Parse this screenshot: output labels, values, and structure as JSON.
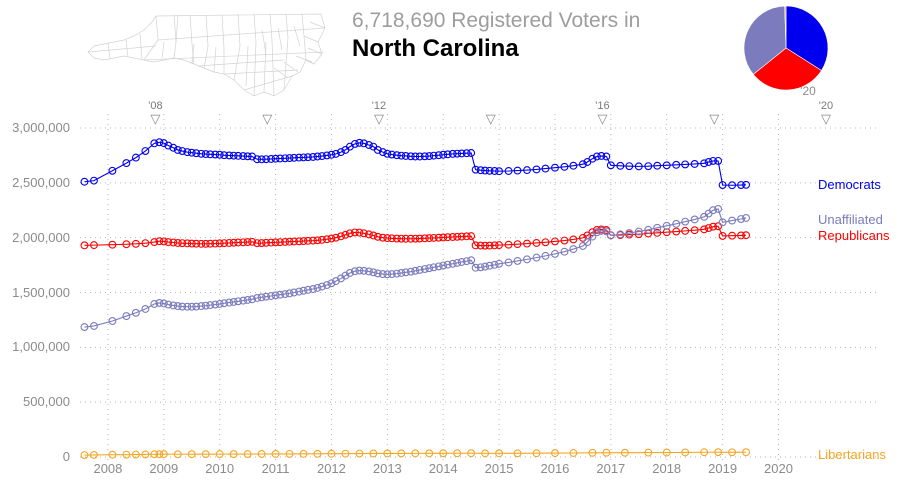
{
  "header": {
    "count_line": "6,718,690 Registered Voters in",
    "state": "North Carolina"
  },
  "map": {
    "name": "north-carolina-county-map"
  },
  "pie": {
    "label": "'20",
    "slices": [
      {
        "name": "Democrats",
        "percent": 34.0,
        "color": "#0000ee"
      },
      {
        "name": "Republicans",
        "percent": 30.2,
        "color": "#fe0000"
      },
      {
        "name": "Unaffiliated",
        "percent": 35.3,
        "color": "#7b7bbd"
      },
      {
        "name": "Libertarians",
        "percent": 0.5,
        "color": "#f5a623"
      }
    ]
  },
  "chart_data": {
    "type": "line",
    "title": "6,718,690 Registered Voters in North Carolina",
    "subtitle": "North Carolina",
    "xlabel": "",
    "ylabel": "",
    "ylim": [
      0,
      3000000
    ],
    "xlim": [
      2007.5,
      2020.6
    ],
    "grid": true,
    "legend_position": "right",
    "ytick_labels": [
      "3,000,000",
      "2,500,000",
      "2,000,000",
      "1,500,000",
      "1,000,000",
      "500,000",
      "0"
    ],
    "ytick_values": [
      3000000,
      2500000,
      2000000,
      1500000,
      1000000,
      500000,
      0
    ],
    "xtick_labels": [
      "2008",
      "2009",
      "2010",
      "2011",
      "2012",
      "2013",
      "2014",
      "2015",
      "2016",
      "2017",
      "2018",
      "2019",
      "2020"
    ],
    "xtick_values": [
      2008,
      2009,
      2010,
      2011,
      2012,
      2013,
      2014,
      2015,
      2016,
      2017,
      2018,
      2019,
      2020
    ],
    "election_markers": [
      {
        "label": "'08",
        "x": 2008.85
      },
      {
        "label": "",
        "x": 2010.85
      },
      {
        "label": "'12",
        "x": 2012.85
      },
      {
        "label": "",
        "x": 2014.85
      },
      {
        "label": "'16",
        "x": 2016.85
      },
      {
        "label": "",
        "x": 2018.85
      },
      {
        "label": "'20",
        "x": 2020.85
      }
    ],
    "series": [
      {
        "name": "Democrats",
        "color": "#0000ee",
        "label": "Democrats",
        "x": [
          2007.58,
          2007.75,
          2008.08,
          2008.33,
          2008.5,
          2008.67,
          2008.83,
          2008.92,
          2009.0,
          2009.08,
          2009.17,
          2009.25,
          2009.33,
          2009.42,
          2009.5,
          2009.58,
          2009.67,
          2009.75,
          2009.83,
          2009.92,
          2010.0,
          2010.08,
          2010.17,
          2010.25,
          2010.33,
          2010.42,
          2010.5,
          2010.58,
          2010.67,
          2010.75,
          2010.83,
          2010.92,
          2011.0,
          2011.08,
          2011.17,
          2011.25,
          2011.33,
          2011.42,
          2011.5,
          2011.58,
          2011.67,
          2011.75,
          2011.83,
          2011.92,
          2012.0,
          2012.08,
          2012.17,
          2012.25,
          2012.33,
          2012.42,
          2012.5,
          2012.58,
          2012.67,
          2012.75,
          2012.83,
          2012.92,
          2013.0,
          2013.08,
          2013.17,
          2013.25,
          2013.33,
          2013.42,
          2013.5,
          2013.58,
          2013.67,
          2013.75,
          2013.83,
          2013.92,
          2014.0,
          2014.08,
          2014.17,
          2014.25,
          2014.33,
          2014.42,
          2014.5,
          2014.58,
          2014.67,
          2014.75,
          2014.83,
          2014.92,
          2015.0,
          2015.17,
          2015.33,
          2015.5,
          2015.67,
          2015.83,
          2016.0,
          2016.17,
          2016.33,
          2016.5,
          2016.58,
          2016.67,
          2016.75,
          2016.83,
          2016.92,
          2017.0,
          2017.17,
          2017.33,
          2017.5,
          2017.67,
          2017.83,
          2018.0,
          2018.17,
          2018.33,
          2018.5,
          2018.67,
          2018.75,
          2018.83,
          2018.92,
          2019.0,
          2019.17,
          2019.33,
          2019.42
        ],
        "y": [
          2510000,
          2520000,
          2610000,
          2680000,
          2730000,
          2790000,
          2860000,
          2870000,
          2862000,
          2840000,
          2820000,
          2800000,
          2790000,
          2780000,
          2775000,
          2770000,
          2765000,
          2762000,
          2760000,
          2758000,
          2756000,
          2752000,
          2750000,
          2748000,
          2746000,
          2744000,
          2742000,
          2740000,
          2715000,
          2714000,
          2716000,
          2718000,
          2720000,
          2722000,
          2724000,
          2726000,
          2728000,
          2730000,
          2732000,
          2734000,
          2736000,
          2740000,
          2744000,
          2750000,
          2756000,
          2764000,
          2780000,
          2800000,
          2830000,
          2855000,
          2865000,
          2860000,
          2845000,
          2830000,
          2800000,
          2780000,
          2765000,
          2758000,
          2752000,
          2748000,
          2745000,
          2742000,
          2740000,
          2740000,
          2742000,
          2744000,
          2748000,
          2752000,
          2756000,
          2760000,
          2764000,
          2766000,
          2768000,
          2770000,
          2772000,
          2620000,
          2615000,
          2612000,
          2610000,
          2608000,
          2606000,
          2608000,
          2612000,
          2616000,
          2622000,
          2630000,
          2638000,
          2646000,
          2656000,
          2670000,
          2690000,
          2720000,
          2740000,
          2745000,
          2740000,
          2660000,
          2655000,
          2652000,
          2650000,
          2652000,
          2656000,
          2660000,
          2664000,
          2668000,
          2672000,
          2678000,
          2690000,
          2700000,
          2700000,
          2480000,
          2478000,
          2480000,
          2482000
        ]
      },
      {
        "name": "Republicans",
        "color": "#fe0000",
        "label": "Republicans",
        "x": [
          2007.58,
          2007.75,
          2008.08,
          2008.33,
          2008.5,
          2008.67,
          2008.83,
          2008.92,
          2009.0,
          2009.08,
          2009.17,
          2009.25,
          2009.33,
          2009.42,
          2009.5,
          2009.58,
          2009.67,
          2009.75,
          2009.83,
          2009.92,
          2010.0,
          2010.08,
          2010.17,
          2010.25,
          2010.33,
          2010.42,
          2010.5,
          2010.58,
          2010.67,
          2010.75,
          2010.83,
          2010.92,
          2011.0,
          2011.08,
          2011.17,
          2011.25,
          2011.33,
          2011.42,
          2011.5,
          2011.58,
          2011.67,
          2011.75,
          2011.83,
          2011.92,
          2012.0,
          2012.08,
          2012.17,
          2012.25,
          2012.33,
          2012.42,
          2012.5,
          2012.58,
          2012.67,
          2012.75,
          2012.83,
          2012.92,
          2013.0,
          2013.08,
          2013.17,
          2013.25,
          2013.33,
          2013.42,
          2013.5,
          2013.58,
          2013.67,
          2013.75,
          2013.83,
          2013.92,
          2014.0,
          2014.08,
          2014.17,
          2014.25,
          2014.33,
          2014.42,
          2014.5,
          2014.58,
          2014.67,
          2014.75,
          2014.83,
          2014.92,
          2015.0,
          2015.17,
          2015.33,
          2015.5,
          2015.67,
          2015.83,
          2016.0,
          2016.17,
          2016.33,
          2016.5,
          2016.58,
          2016.67,
          2016.75,
          2016.83,
          2016.92,
          2017.0,
          2017.17,
          2017.33,
          2017.5,
          2017.67,
          2017.83,
          2018.0,
          2018.17,
          2018.33,
          2018.5,
          2018.67,
          2018.75,
          2018.83,
          2018.92,
          2019.0,
          2019.17,
          2019.33,
          2019.42
        ],
        "y": [
          1930000,
          1932000,
          1936000,
          1940000,
          1944000,
          1950000,
          1960000,
          1968000,
          1966000,
          1960000,
          1956000,
          1952000,
          1950000,
          1948000,
          1946000,
          1945000,
          1944000,
          1944000,
          1945000,
          1946000,
          1948000,
          1950000,
          1952000,
          1954000,
          1956000,
          1958000,
          1960000,
          1962000,
          1950000,
          1951000,
          1953000,
          1955000,
          1957000,
          1959000,
          1961000,
          1963000,
          1965000,
          1967000,
          1969000,
          1971000,
          1973000,
          1976000,
          1980000,
          1986000,
          1992000,
          2000000,
          2012000,
          2026000,
          2040000,
          2048000,
          2046000,
          2040000,
          2030000,
          2020000,
          2008000,
          2000000,
          1996000,
          1994000,
          1992000,
          1991000,
          1990000,
          1990000,
          1991000,
          1992000,
          1994000,
          1996000,
          1998000,
          2000000,
          2002000,
          2004000,
          2006000,
          2008000,
          2010000,
          2012000,
          2014000,
          1930000,
          1928000,
          1927000,
          1928000,
          1930000,
          1932000,
          1936000,
          1941000,
          1946000,
          1952000,
          1958000,
          1966000,
          1974000,
          1984000,
          1998000,
          2020000,
          2050000,
          2070000,
          2075000,
          2070000,
          2022000,
          2024000,
          2028000,
          2032000,
          2038000,
          2044000,
          2050000,
          2056000,
          2062000,
          2068000,
          2076000,
          2088000,
          2100000,
          2104000,
          2016000,
          2018000,
          2020000,
          2022000
        ]
      },
      {
        "name": "Unaffiliated",
        "color": "#7b7bbd",
        "label": "Unaffiliated",
        "x": [
          2007.58,
          2007.75,
          2008.08,
          2008.33,
          2008.5,
          2008.67,
          2008.83,
          2008.92,
          2009.0,
          2009.08,
          2009.17,
          2009.25,
          2009.33,
          2009.42,
          2009.5,
          2009.58,
          2009.67,
          2009.75,
          2009.83,
          2009.92,
          2010.0,
          2010.08,
          2010.17,
          2010.25,
          2010.33,
          2010.42,
          2010.5,
          2010.58,
          2010.67,
          2010.75,
          2010.83,
          2010.92,
          2011.0,
          2011.08,
          2011.17,
          2011.25,
          2011.33,
          2011.42,
          2011.5,
          2011.58,
          2011.67,
          2011.75,
          2011.83,
          2011.92,
          2012.0,
          2012.08,
          2012.17,
          2012.25,
          2012.33,
          2012.42,
          2012.5,
          2012.58,
          2012.67,
          2012.75,
          2012.83,
          2012.92,
          2013.0,
          2013.08,
          2013.17,
          2013.25,
          2013.33,
          2013.42,
          2013.5,
          2013.58,
          2013.67,
          2013.75,
          2013.83,
          2013.92,
          2014.0,
          2014.08,
          2014.17,
          2014.25,
          2014.33,
          2014.42,
          2014.5,
          2014.58,
          2014.67,
          2014.75,
          2014.83,
          2014.92,
          2015.0,
          2015.17,
          2015.33,
          2015.5,
          2015.67,
          2015.83,
          2016.0,
          2016.17,
          2016.33,
          2016.5,
          2016.58,
          2016.67,
          2016.75,
          2016.83,
          2016.92,
          2017.0,
          2017.17,
          2017.33,
          2017.5,
          2017.67,
          2017.83,
          2018.0,
          2018.17,
          2018.33,
          2018.5,
          2018.67,
          2018.75,
          2018.83,
          2018.92,
          2019.0,
          2019.17,
          2019.33,
          2019.42
        ],
        "y": [
          1185000,
          1195000,
          1240000,
          1285000,
          1315000,
          1350000,
          1395000,
          1405000,
          1400000,
          1390000,
          1382000,
          1376000,
          1372000,
          1370000,
          1370000,
          1372000,
          1376000,
          1380000,
          1385000,
          1390000,
          1396000,
          1402000,
          1408000,
          1414000,
          1420000,
          1426000,
          1432000,
          1438000,
          1450000,
          1456000,
          1462000,
          1468000,
          1474000,
          1480000,
          1486000,
          1492000,
          1500000,
          1508000,
          1516000,
          1524000,
          1532000,
          1542000,
          1554000,
          1568000,
          1584000,
          1604000,
          1628000,
          1654000,
          1678000,
          1694000,
          1700000,
          1698000,
          1692000,
          1684000,
          1674000,
          1668000,
          1666000,
          1668000,
          1672000,
          1678000,
          1684000,
          1690000,
          1698000,
          1706000,
          1714000,
          1722000,
          1730000,
          1738000,
          1746000,
          1754000,
          1762000,
          1770000,
          1778000,
          1786000,
          1794000,
          1726000,
          1730000,
          1736000,
          1744000,
          1752000,
          1762000,
          1774000,
          1788000,
          1802000,
          1818000,
          1834000,
          1852000,
          1872000,
          1896000,
          1924000,
          1960000,
          2010000,
          2050000,
          2062000,
          2058000,
          2020000,
          2030000,
          2042000,
          2056000,
          2072000,
          2090000,
          2108000,
          2126000,
          2146000,
          2166000,
          2190000,
          2220000,
          2250000,
          2262000,
          2140000,
          2156000,
          2170000,
          2180000
        ]
      },
      {
        "name": "Libertarians",
        "color": "#f5a623",
        "label": "Libertarians",
        "x": [
          2007.58,
          2007.75,
          2008.08,
          2008.33,
          2008.5,
          2008.67,
          2008.83,
          2008.92,
          2009.0,
          2009.25,
          2009.5,
          2009.75,
          2010.0,
          2010.25,
          2010.5,
          2010.75,
          2011.0,
          2011.25,
          2011.5,
          2011.75,
          2012.0,
          2012.25,
          2012.5,
          2012.75,
          2013.0,
          2013.25,
          2013.5,
          2013.75,
          2014.0,
          2014.25,
          2014.5,
          2014.75,
          2015.0,
          2015.33,
          2015.67,
          2016.0,
          2016.33,
          2016.67,
          2016.92,
          2017.25,
          2017.67,
          2018.0,
          2018.33,
          2018.67,
          2018.92,
          2019.17,
          2019.42
        ],
        "y": [
          18000,
          19000,
          20500,
          21500,
          22500,
          23500,
          25000,
          25500,
          25300,
          25200,
          25400,
          25800,
          26200,
          26600,
          27000,
          27400,
          27800,
          28200,
          28600,
          29200,
          29800,
          30600,
          31600,
          32200,
          32400,
          32600,
          33000,
          33400,
          33800,
          34200,
          34600,
          33000,
          33400,
          34000,
          34800,
          35600,
          36600,
          38200,
          39400,
          39000,
          40000,
          41000,
          42000,
          43200,
          44000,
          43000,
          43500
        ]
      }
    ]
  },
  "series_legend": [
    {
      "name": "Democrats",
      "label": "Democrats",
      "color": "#0000ee",
      "top": 177
    },
    {
      "name": "Unaffiliated",
      "label": "Unaffiliated",
      "color": "#7b7bbd",
      "top": 212
    },
    {
      "name": "Republicans",
      "label": "Republicans",
      "color": "#fe0000",
      "top": 228
    },
    {
      "name": "Libertarians",
      "label": "Libertarians",
      "color": "#f5a623",
      "top": 447
    }
  ]
}
